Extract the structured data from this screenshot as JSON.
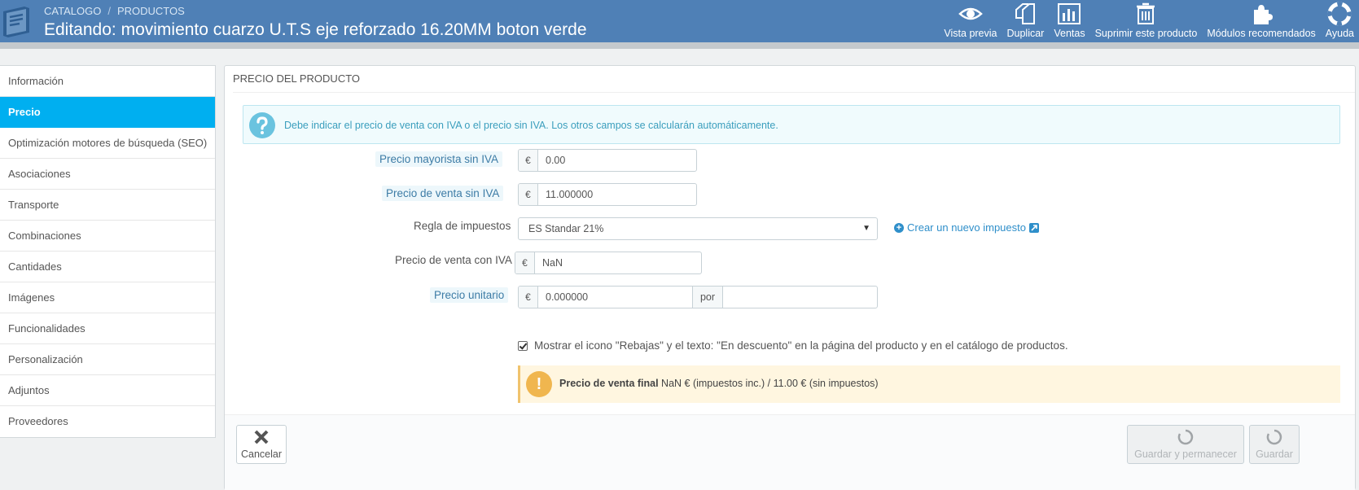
{
  "header": {
    "breadcrumb": [
      "CATALOGO",
      "PRODUCTOS"
    ],
    "breadcrumb_sep": "/",
    "title": "Editando: movimiento cuarzo U.T.S eje reforzado 16.20MM boton verde",
    "toolbar": [
      {
        "label": "Vista previa",
        "icon": "eye-icon"
      },
      {
        "label": "Duplicar",
        "icon": "copy-icon"
      },
      {
        "label": "Ventas",
        "icon": "bar-chart-icon"
      },
      {
        "label": "Suprimir este producto",
        "icon": "trash-icon"
      },
      {
        "label": "Módulos recomendados",
        "icon": "puzzle-icon"
      },
      {
        "label": "Ayuda",
        "icon": "lifebuoy-icon"
      }
    ]
  },
  "sidebar": {
    "active_index": 1,
    "items": [
      {
        "label": "Información"
      },
      {
        "label": "Precio"
      },
      {
        "label": "Optimización motores de búsqueda (SEO)"
      },
      {
        "label": "Asociaciones"
      },
      {
        "label": "Transporte"
      },
      {
        "label": "Combinaciones"
      },
      {
        "label": "Cantidades"
      },
      {
        "label": "Imágenes"
      },
      {
        "label": "Funcionalidades"
      },
      {
        "label": "Personalización"
      },
      {
        "label": "Adjuntos"
      },
      {
        "label": "Proveedores"
      }
    ]
  },
  "panel": {
    "heading": "PRECIO DEL PRODUCTO",
    "info": "Debe indicar el precio de venta con IVA o el precio sin IVA. Los otros campos se calcularán automáticamente.",
    "wholesale": {
      "label": "Precio mayorista sin IVA",
      "currency": "€",
      "value": "0.00"
    },
    "retail": {
      "label": "Precio de venta sin IVA",
      "currency": "€",
      "value": "11.000000"
    },
    "tax_rule": {
      "label": "Regla de impuestos",
      "value": "ES Standar 21%",
      "new_link": "Crear un nuevo impuesto"
    },
    "retail_tax": {
      "label": "Precio de venta con IVA",
      "currency": "€",
      "value": "NaN"
    },
    "unit_price": {
      "label": "Precio unitario",
      "currency": "€",
      "value": "0.000000",
      "per": "por",
      "unit": ""
    },
    "on_sale": {
      "checked": true,
      "label": "Mostrar el icono \"Rebajas\" y el texto: \"En descuento\" en la página del producto y en el catálogo de productos."
    },
    "final_price": {
      "bold": "Precio de venta final",
      "text": " NaN € (impuestos inc.) / 11.00 € (sin impuestos)"
    }
  },
  "footer": {
    "cancel": "Cancelar",
    "save_stay": "Guardar y permanecer",
    "save": "Guardar"
  },
  "colors": {
    "header_bg": "#4f80b6",
    "active_tab": "#00aff0",
    "info_text": "#3a9ebd",
    "warning_icon": "#f0b64f"
  }
}
